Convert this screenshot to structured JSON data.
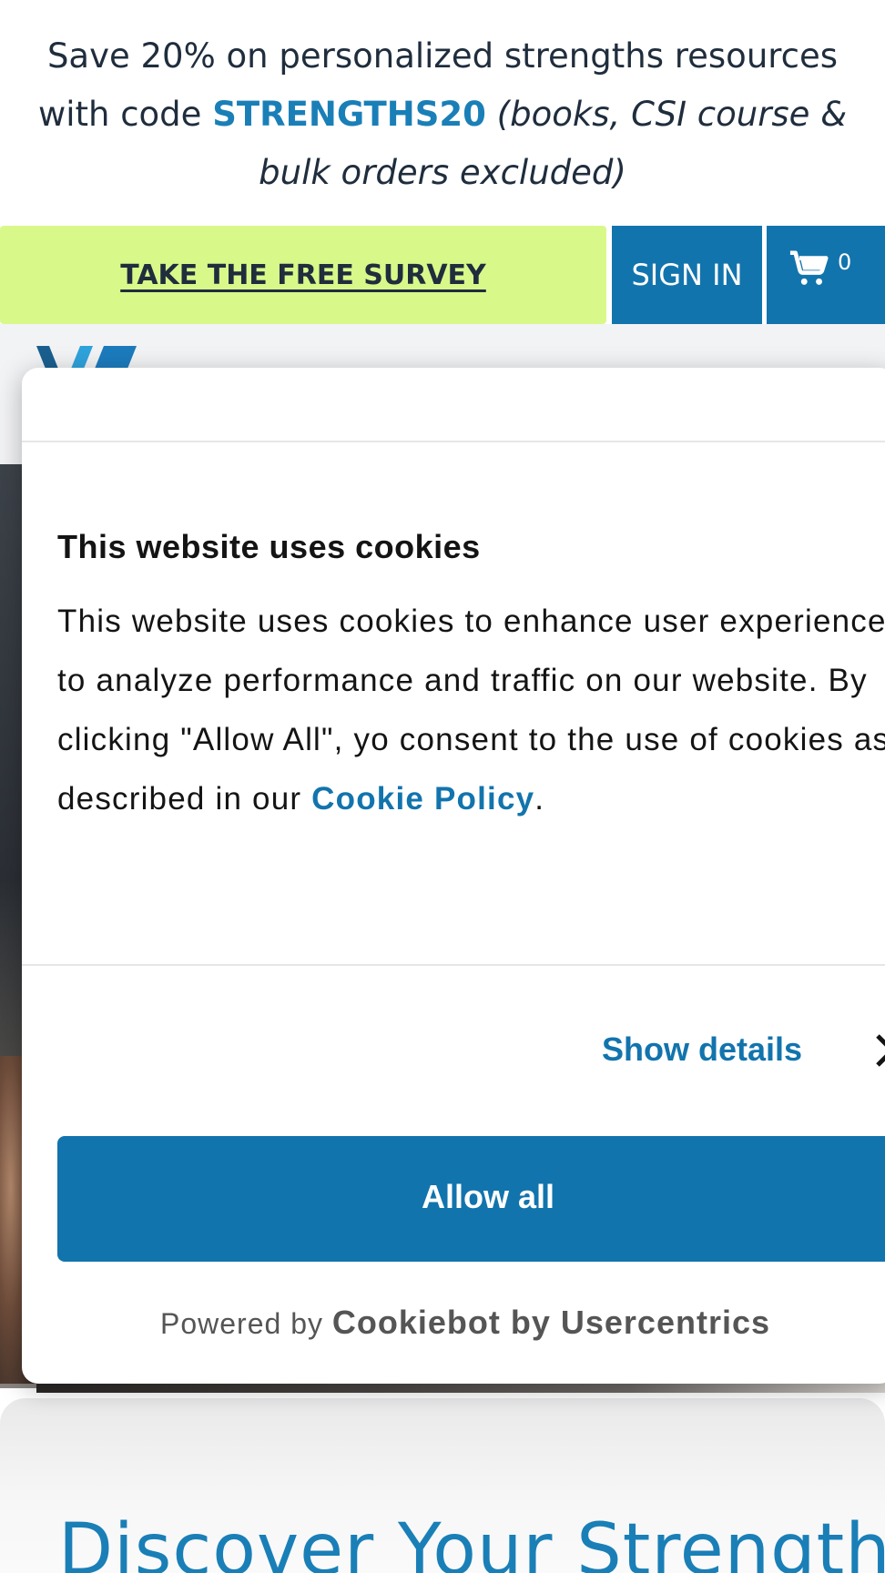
{
  "promo": {
    "line_prefix": "Save 20% on personalized strengths resources with code",
    "code": "STRENGTHS20",
    "exclusion": "(books, CSI course & bulk orders excluded)"
  },
  "nav": {
    "survey_label": "TAKE THE FREE SURVEY",
    "signin_label": "SIGN IN",
    "cart_count": "0"
  },
  "cookie_dialog": {
    "title": "This website uses cookies",
    "body": "This website uses cookies to enhance user experience, and to analyze performance and traffic on our website. By clicking \"Allow All\", yo consent to the use of cookies as described in our",
    "policy_link": "Cookie Policy",
    "body_end": ".",
    "show_details": "Show details",
    "allow_all": "Allow all",
    "powered_prefix": "Powered by",
    "powered_brand": "Cookiebot by Usercentrics"
  },
  "page": {
    "heading": "Discover Your Strengths"
  },
  "colors": {
    "brand_blue": "#1274ad",
    "survey_green": "#d8f98a",
    "text_dark": "#1f2d3d"
  }
}
